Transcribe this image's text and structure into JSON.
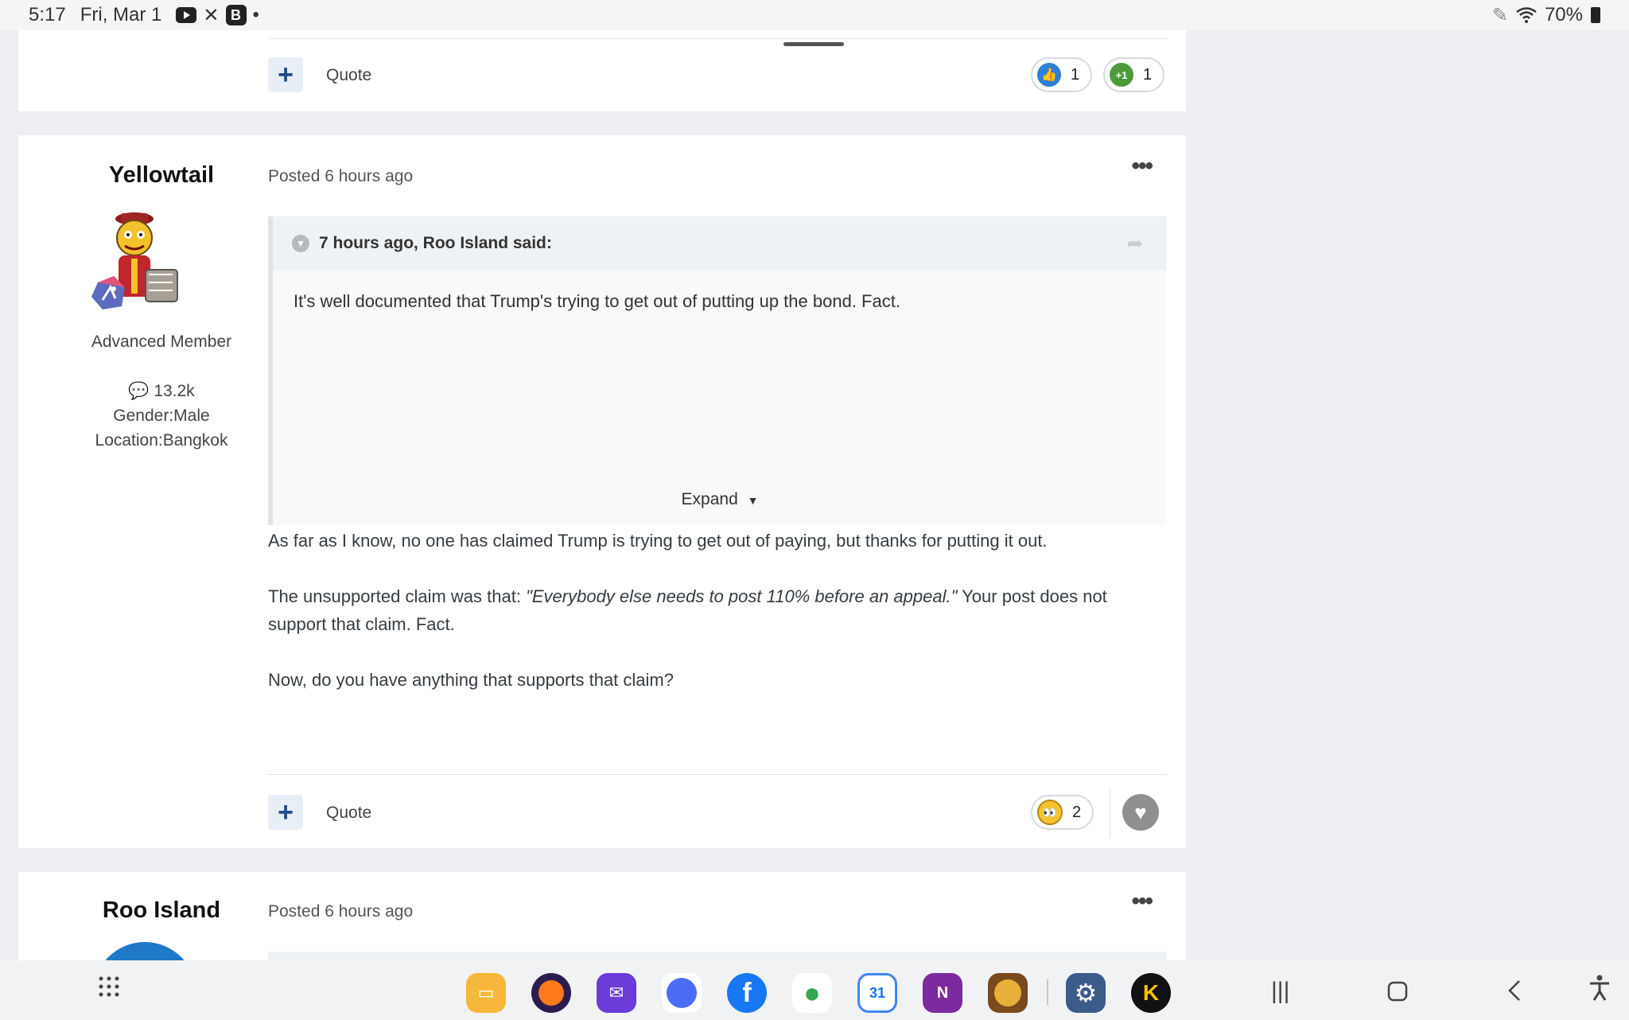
{
  "status_bar": {
    "time": "5:17",
    "date": "Fri, Mar 1",
    "dot": "•",
    "battery": "70%"
  },
  "post_top": {
    "quote_label": "Quote",
    "reactions": [
      {
        "icon": "thumbs-up-icon",
        "count": "1"
      },
      {
        "icon": "plus-one-icon",
        "glyph": "+1",
        "count": "1"
      }
    ]
  },
  "post_main": {
    "author": "Yellowtail",
    "rank": "Advanced Member",
    "post_count": "13.2k",
    "gender": "Gender:Male",
    "location": "Location:Bangkok",
    "posted": "Posted 6 hours ago",
    "quote": {
      "citation": "7 hours ago, Roo Island said:",
      "text": "It's well documented that Trump's trying to get out of putting up the bond. Fact.",
      "expand_label": "Expand"
    },
    "body": {
      "p1": "As far as I know, no one has claimed Trump is trying to get out of paying, but thanks for putting it out.",
      "p2_prefix": "The unsupported claim was that:  ",
      "p2_quote": "\"Everybody else needs to post 110% before an appeal.\"",
      "p2_suffix": "  Your post does not support that claim. Fact.",
      "p3": "Now, do you have anything that supports that claim?"
    },
    "quote_label": "Quote",
    "reaction_count": "2"
  },
  "post_next": {
    "author": "Roo Island",
    "posted": "Posted 6 hours ago"
  },
  "dock": {
    "apps": [
      "files-app-icon",
      "firefox-app-icon",
      "mail-app-icon",
      "messenger-app-icon",
      "facebook-app-icon",
      "maps-app-icon",
      "calendar-app-icon",
      "onenote-app-icon",
      "clash-app-icon",
      "settings-app-icon",
      "keeper-app-icon"
    ],
    "calendar_day": "31",
    "onenote_letter": "N"
  }
}
